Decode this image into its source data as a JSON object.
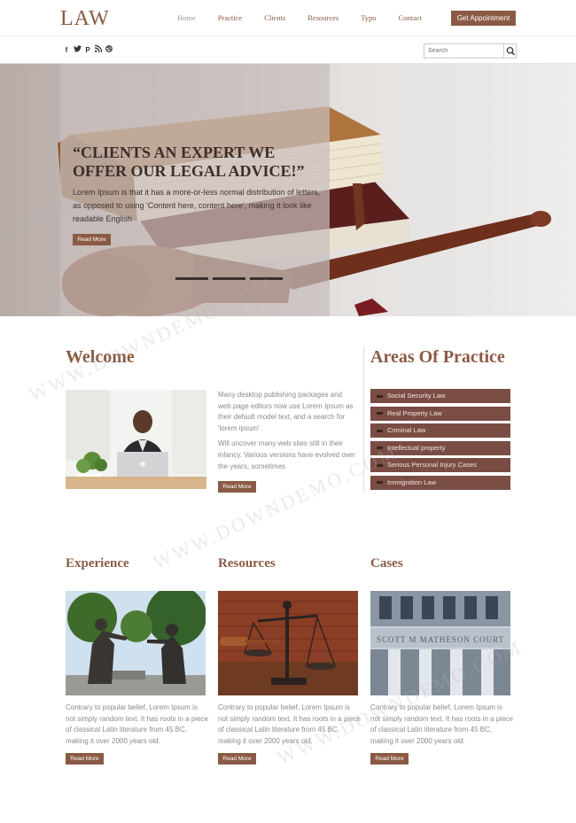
{
  "header": {
    "logo": "LAW",
    "nav": [
      {
        "label": "Home",
        "active": true
      },
      {
        "label": "Practice"
      },
      {
        "label": "Clients"
      },
      {
        "label": "Resources"
      },
      {
        "label": "Typo"
      },
      {
        "label": "Contact"
      }
    ],
    "cta_label": "Get Appointment"
  },
  "subbar": {
    "socials": [
      "facebook-icon",
      "twitter-icon",
      "pinterest-icon",
      "rss-icon",
      "dribbble-icon"
    ],
    "search_placeholder": "Search"
  },
  "hero": {
    "title": "“CLIENTS AN EXPERT WE OFFER OUR LEGAL ADVICE!”",
    "text": "Lorem Ipsum is that it has a more-or-less normal distribution of letters, as opposed to using 'Content here, content here', making it look like readable English",
    "button": "Read More",
    "slides": 3
  },
  "welcome": {
    "title": "Welcome",
    "paragraph1": "Many desktop publishing packages and web page editors now use Lorem Ipsum as their default model text, and a search for 'lorem ipsum'",
    "paragraph2": "Will uncover many web sites still in their infancy. Various versions have evolved over the years, sometimes",
    "button": "Read More"
  },
  "areas": {
    "title": "Areas Of Practice",
    "items": [
      "Social Security Law",
      "Real Property Law",
      "Criminal Law",
      "Intellectual property",
      "Serious Personal Injury Cases",
      "Immigration Law"
    ]
  },
  "columns": [
    {
      "title": "Experience",
      "text": "Contrary to popular belief, Lorem Ipsum is not simply random text. It has roots in a piece of classical Latin literature from 45 BC, making it over 2000 years old.",
      "button": "Read More"
    },
    {
      "title": "Resources",
      "text": "Contrary to popular belief, Lorem Ipsum is not simply random text. It has roots in a piece of classical Latin literature from 45 BC, making it over 2000 years old.",
      "button": "Read More"
    },
    {
      "title": "Cases",
      "text": "Contrary to popular belief, Lorem Ipsum is not simply random text. It has roots in a piece of classical Latin literature from 45 BC, making it over 2000 years old.",
      "button": "Read More"
    }
  ],
  "colors": {
    "accent": "#8a5a44",
    "practice_bg": "#7a4d44"
  },
  "watermark": "WWW.DOWNDEMO.COM",
  "watermark_short": "WWW.DO",
  "courthouse_sign": "SCOTT M MATHESON COURT"
}
